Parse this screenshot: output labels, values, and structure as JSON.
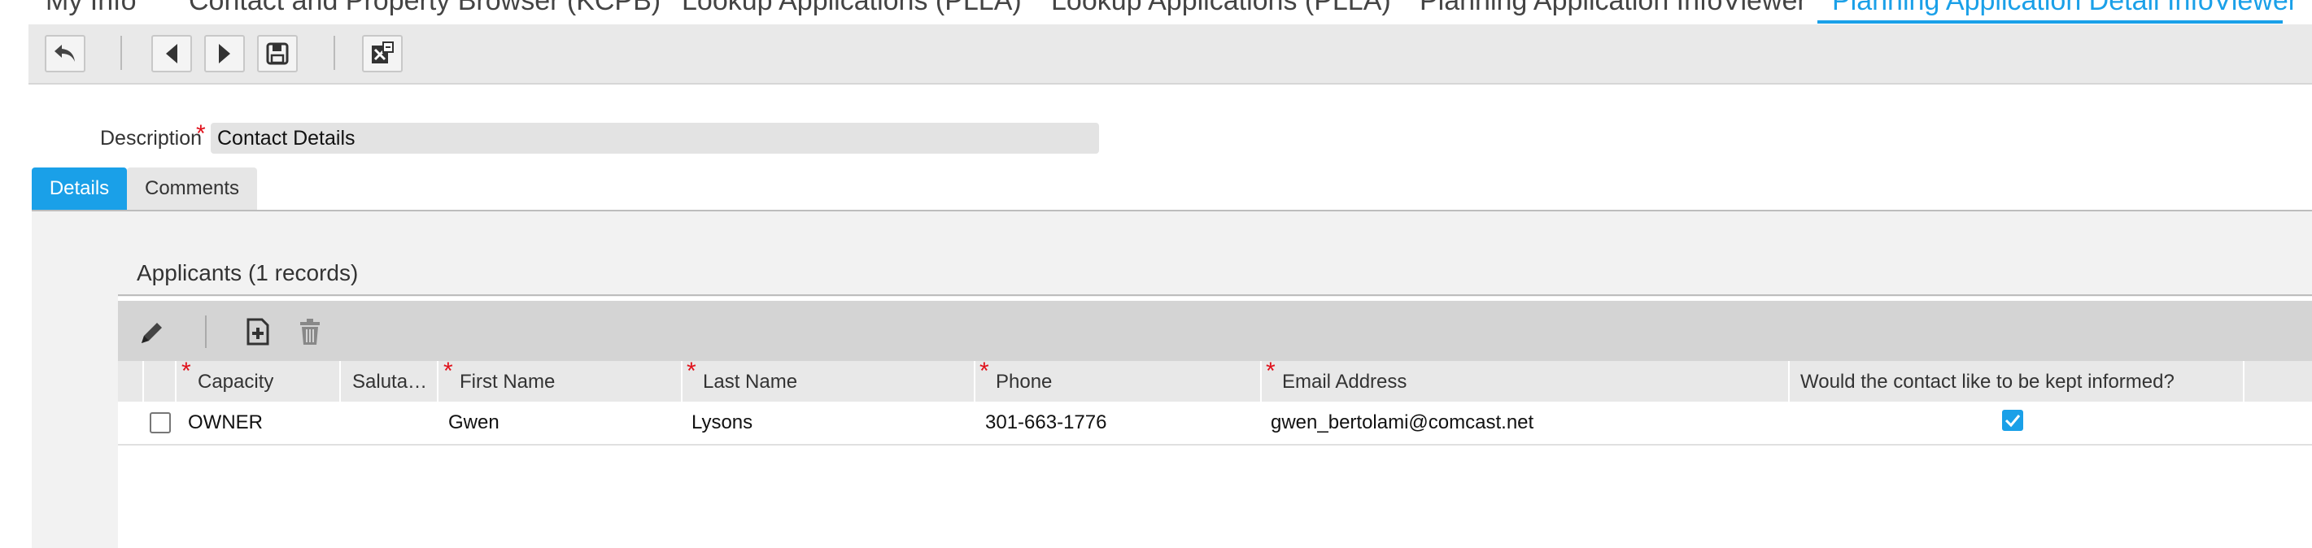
{
  "tabs": [
    {
      "label": "My Info"
    },
    {
      "label": "Contact and Property Browser (KCPB)"
    },
    {
      "label": "Lookup Applications (PLLA)"
    },
    {
      "label": "Lookup Applications (PLLA)"
    },
    {
      "label": "Planning Application InfoViewer"
    },
    {
      "label": "Planning Application Detail InfoViewer",
      "active": true
    }
  ],
  "form": {
    "description_label": "Description",
    "description_value": "Contact Details"
  },
  "subtabs": {
    "details": "Details",
    "comments": "Comments"
  },
  "applicants": {
    "title": "Applicants (1 records)",
    "columns": [
      "Capacity",
      "Saluta…",
      "First Name",
      "Last Name",
      "Phone",
      "Email Address",
      "Would the contact like to be kept informed?"
    ],
    "rows": [
      {
        "capacity": "OWNER",
        "salutation": "",
        "first_name": "Gwen",
        "last_name": "Lysons",
        "phone": "301-663-1776",
        "email": "gwen_bertolami@comcast.net",
        "kept_informed": true
      }
    ]
  },
  "colors": {
    "accent": "#1aa0e8",
    "required": "#e0111b"
  }
}
